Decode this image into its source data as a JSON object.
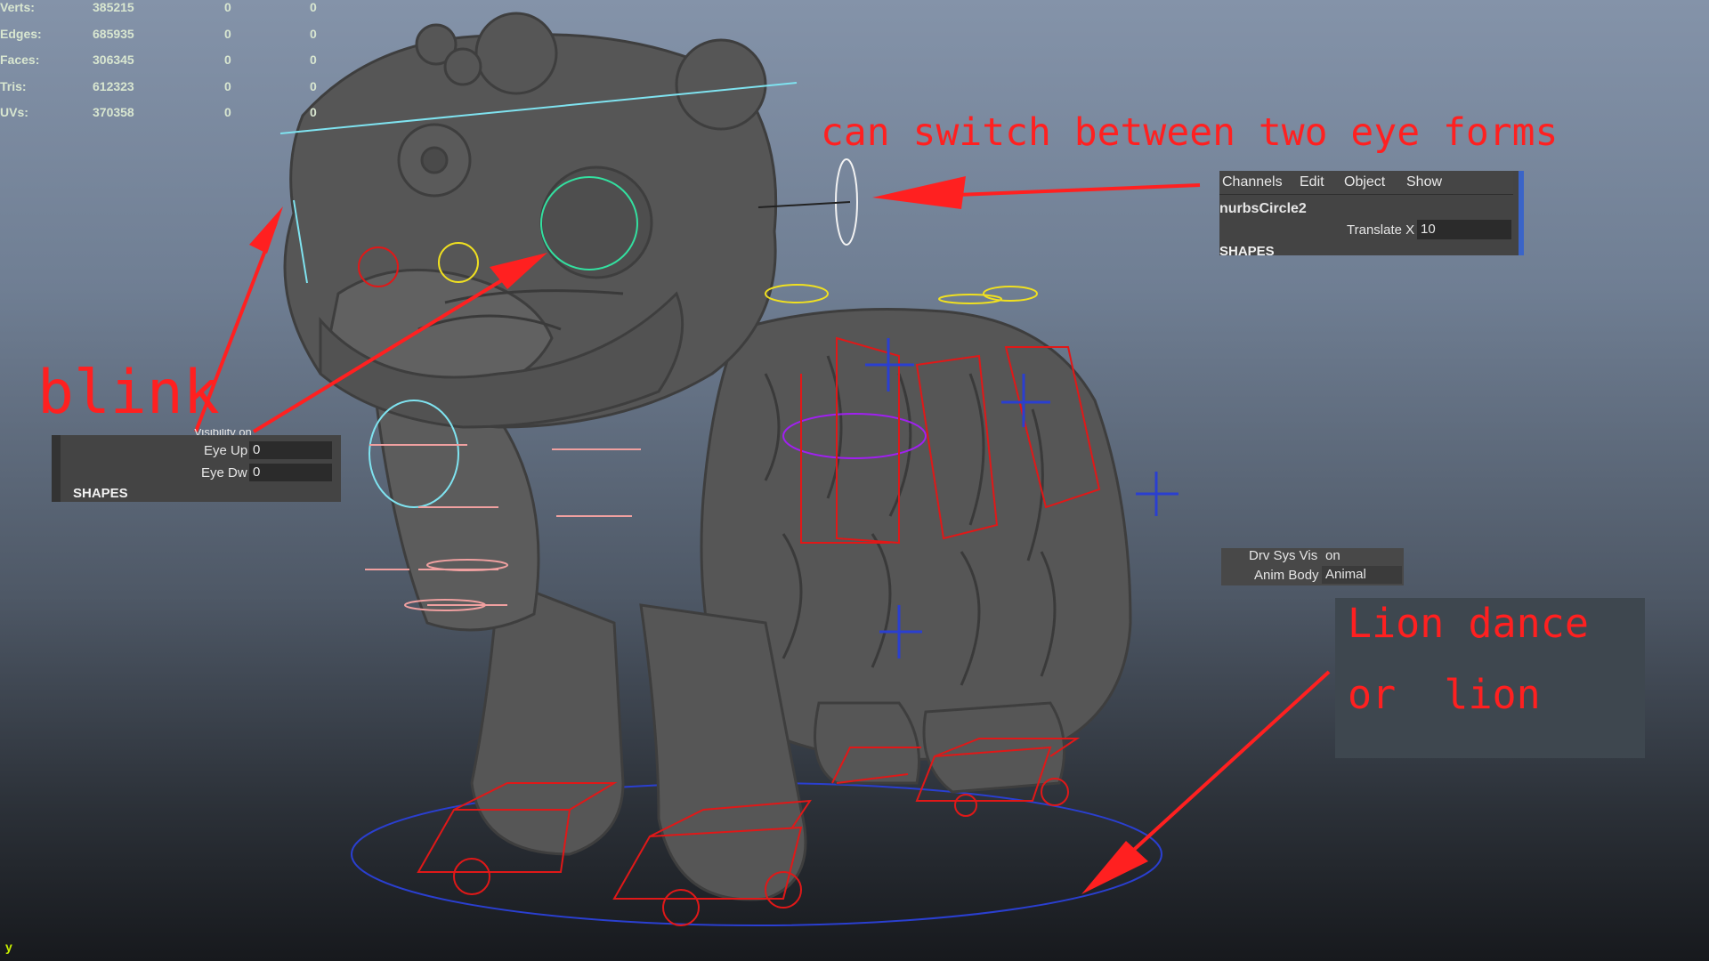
{
  "hud": {
    "rows": [
      {
        "label": "Verts:",
        "v1": "385215",
        "v2": "0",
        "v3": "0"
      },
      {
        "label": "Edges:",
        "v1": "685935",
        "v2": "0",
        "v3": "0"
      },
      {
        "label": "Faces:",
        "v1": "306345",
        "v2": "0",
        "v3": "0"
      },
      {
        "label": "Tris:",
        "v1": "612323",
        "v2": "0",
        "v3": "0"
      },
      {
        "label": "UVs:",
        "v1": "370358",
        "v2": "0",
        "v3": "0"
      }
    ]
  },
  "annotations": {
    "top": "can switch between two eye forms",
    "blink": "blink",
    "lion_line1": "Lion dance",
    "lion_line2": "or  lion"
  },
  "channel_box": {
    "menus": [
      "Channels",
      "Edit",
      "Object",
      "Show"
    ],
    "node": "nurbsCircle2",
    "attr_label": "Translate X",
    "attr_value": "10",
    "section": "SHAPES"
  },
  "eye_panel": {
    "partial": "Visibility on",
    "eye_up_label": "Eye Up",
    "eye_up_value": "0",
    "eye_dw_label": "Eye Dw",
    "eye_dw_value": "0",
    "section": "SHAPES"
  },
  "drv_panel": {
    "row1_label": "Drv Sys Vis",
    "row1_value": "on",
    "row2_label": "Anim Body",
    "row2_value": "Animal"
  },
  "axis": {
    "label": "y"
  },
  "colors": {
    "annotation": "#ff2020",
    "rig_red": "#e01818",
    "rig_blue": "#2a3fd0",
    "rig_cyan": "#7fe3f0",
    "rig_yellow": "#f0e020",
    "rig_pink": "#f0a0a0",
    "rig_green": "#33e0a0",
    "rig_purple": "#a020f0"
  }
}
